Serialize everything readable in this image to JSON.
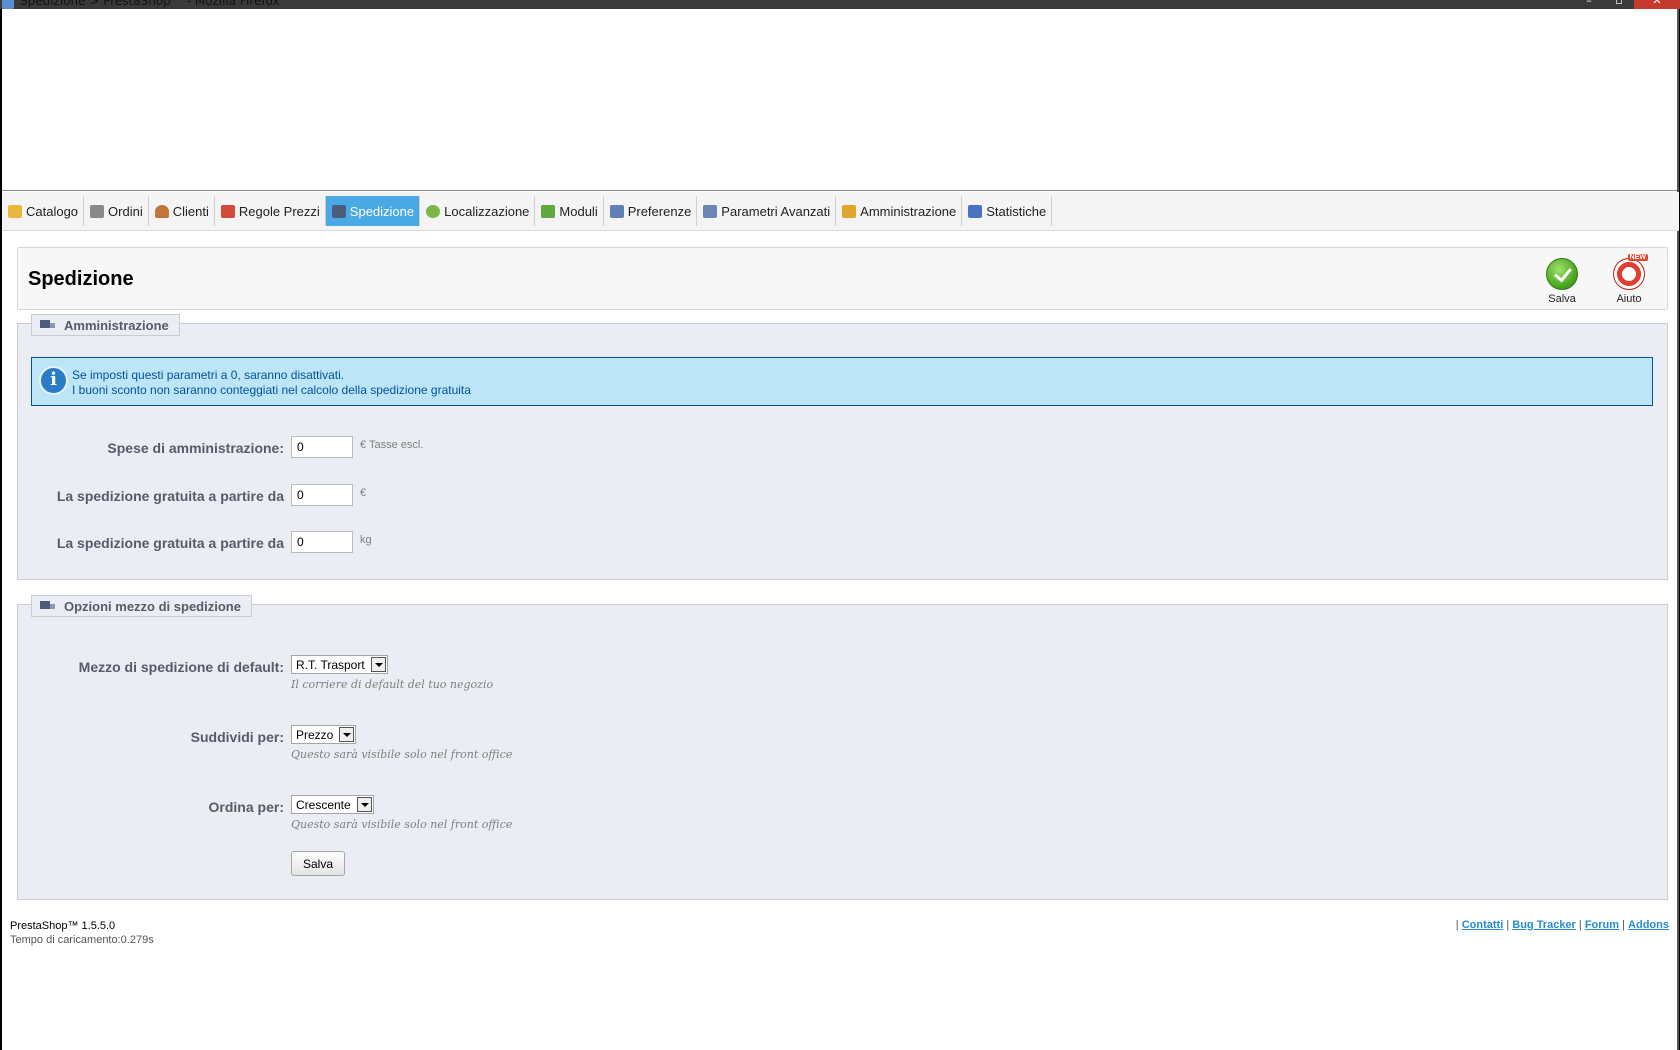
{
  "window": {
    "title": "Spedizione > PrestaShop™ - Mozilla Firefox"
  },
  "menu": {
    "tabs": [
      {
        "label": "Catalogo",
        "icon": "folder-icon",
        "color": "#e8b83c"
      },
      {
        "label": "Ordini",
        "icon": "cart-icon",
        "color": "#8a8a8a"
      },
      {
        "label": "Clienti",
        "icon": "user-icon",
        "color": "#c2743b"
      },
      {
        "label": "Regole Prezzi",
        "icon": "price-tag-icon",
        "color": "#d34a3a"
      },
      {
        "label": "Spedizione",
        "icon": "truck-icon",
        "color": "#4d5c7a",
        "active": true
      },
      {
        "label": "Localizzazione",
        "icon": "globe-icon",
        "color": "#7ab648"
      },
      {
        "label": "Moduli",
        "icon": "puzzle-icon",
        "color": "#5caa3c"
      },
      {
        "label": "Preferenze",
        "icon": "preferences-icon",
        "color": "#5f7fb5"
      },
      {
        "label": "Parametri Avanzati",
        "icon": "wrench-icon",
        "color": "#6a86b8"
      },
      {
        "label": "Amministrazione",
        "icon": "key-icon",
        "color": "#e0a52c"
      },
      {
        "label": "Statistiche",
        "icon": "bar-chart-icon",
        "color": "#4a72c4"
      }
    ]
  },
  "toolbar": {
    "title": "Spedizione",
    "save_label": "Salva",
    "help_label": "Aiuto",
    "help_badge": "NEW"
  },
  "admin_section": {
    "legend": "Amministrazione",
    "info_line1": "Se imposti questi parametri a 0, saranno disattivati.",
    "info_line2": "I buoni sconto non saranno conteggiati nel calcolo della spedizione gratuita",
    "fields": [
      {
        "label": "Spese di amministrazione:",
        "value": "0",
        "unit": "€ Tasse escl."
      },
      {
        "label": "La spedizione gratuita a partire da",
        "value": "0",
        "unit": "€"
      },
      {
        "label": "La spedizione gratuita a partire da",
        "value": "0",
        "unit": "kg"
      }
    ]
  },
  "options_section": {
    "legend": "Opzioni mezzo di spedizione",
    "fields": [
      {
        "label": "Mezzo di spedizione di default:",
        "value": "R.T. Trasport",
        "hint": "Il corriere di default del tuo negozio"
      },
      {
        "label": "Suddividi per:",
        "value": "Prezzo",
        "hint": "Questo sarà visibile solo nel front office"
      },
      {
        "label": "Ordina per:",
        "value": "Crescente",
        "hint": "Questo sarà visibile solo nel front office"
      }
    ],
    "save_label": "Salva"
  },
  "footer": {
    "version": "PrestaShop™ 1.5.5.0",
    "load_time": "Tempo di caricamento:0.279s",
    "links": [
      "Contatti",
      "Bug Tracker",
      "Forum",
      "Addons"
    ]
  }
}
